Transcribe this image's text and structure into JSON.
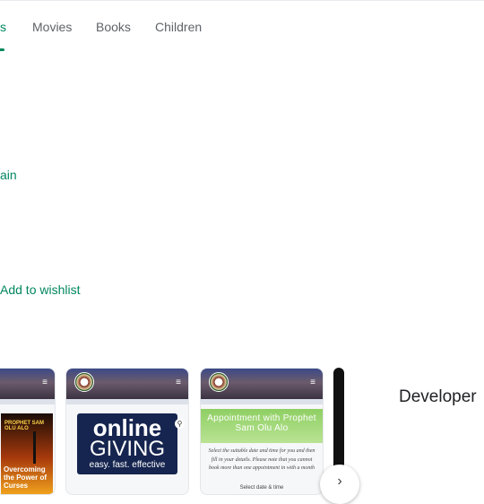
{
  "tabs": [
    {
      "label": "s"
    },
    {
      "label": "Movies"
    },
    {
      "label": "Books"
    },
    {
      "label": "Children"
    }
  ],
  "action_partial": "ain",
  "wishlist_label": "Add to wishlist",
  "section_heading": "Developer",
  "screenshots": {
    "menu_glyph": "≡",
    "poster_top": "PROPHET SAM OLU ALO",
    "poster_title": "Overcoming the Power of Curses",
    "giving_line1": "online",
    "giving_line2": "GIVING",
    "giving_line3": "easy. fast. effective",
    "zoom_glyph": "⚲",
    "appointment_title": "Appointment with Prophet Sam Olu Alo",
    "appointment_text": "Select the suitable date and time for you and then fill in your details. Please note that you cannot book more than one appointment in with a month",
    "appointment_field_label": "Select date & time"
  },
  "next_glyph": "›",
  "colors": {
    "accent": "#01875f",
    "tab_text": "#5f6368",
    "heading": "#202124"
  }
}
